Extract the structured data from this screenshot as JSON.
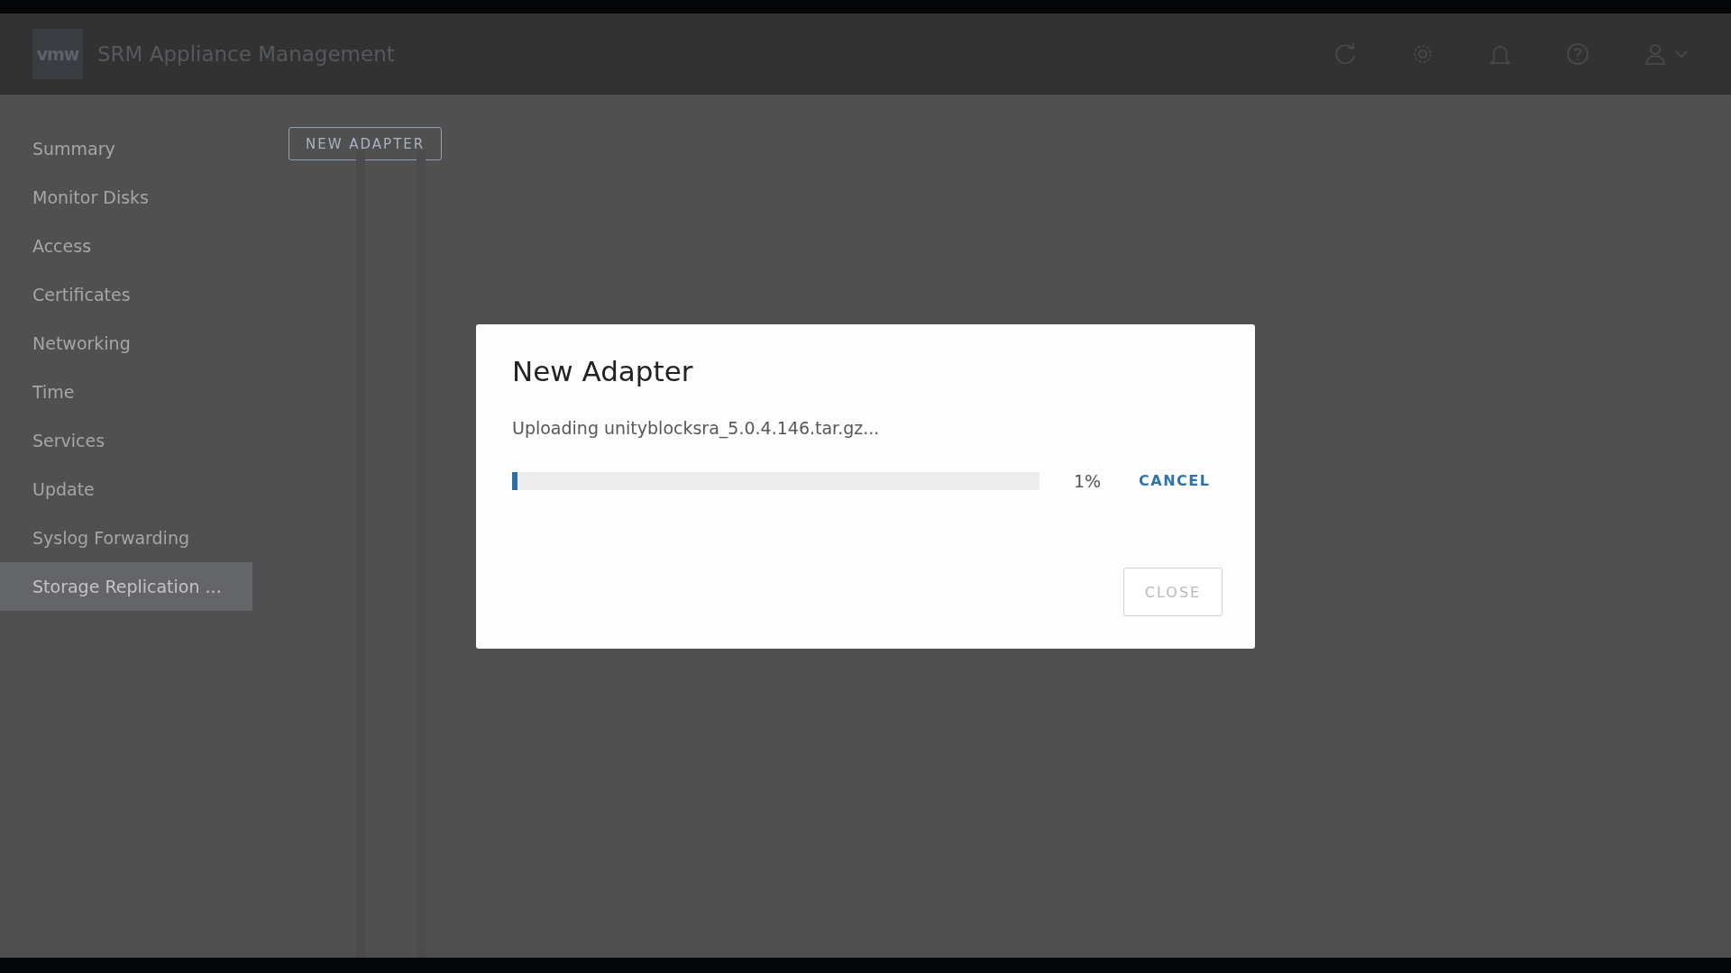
{
  "header": {
    "logo": "vmw",
    "title": "SRM Appliance Management"
  },
  "sidebar": {
    "items": [
      {
        "label": "Summary",
        "selected": false
      },
      {
        "label": "Monitor Disks",
        "selected": false
      },
      {
        "label": "Access",
        "selected": false
      },
      {
        "label": "Certificates",
        "selected": false
      },
      {
        "label": "Networking",
        "selected": false
      },
      {
        "label": "Time",
        "selected": false
      },
      {
        "label": "Services",
        "selected": false
      },
      {
        "label": "Update",
        "selected": false
      },
      {
        "label": "Syslog Forwarding",
        "selected": false
      },
      {
        "label": "Storage Replication ...",
        "selected": true
      }
    ]
  },
  "toolbar": {
    "new_button": "NEW ADAPTER"
  },
  "dialog": {
    "title": "New Adapter",
    "message": "Uploading unityblocksra_5.0.4.146.tar.gz...",
    "progress": {
      "level": 0.01,
      "percent": "1%"
    },
    "cancel": "CANCEL",
    "close": {
      "label": "CLOSE",
      "disabled": true
    }
  }
}
